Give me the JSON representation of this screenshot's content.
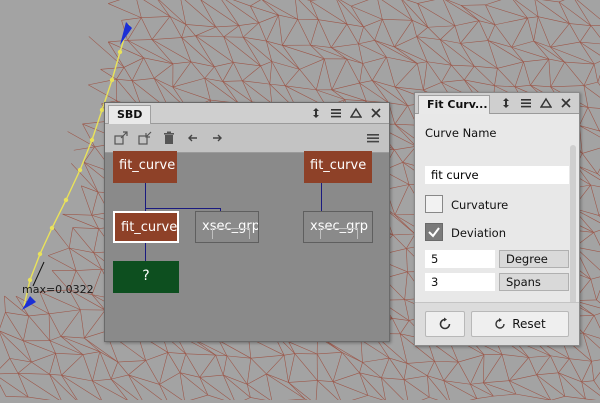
{
  "viewport": {
    "max_label": "max=0.0322"
  },
  "sbd": {
    "title": "SBD",
    "nodes": {
      "fit_curve_top_left": "fit_curve",
      "fit_curve_top_right": "fit_curve",
      "fit_curve_selected": "fit_curve",
      "xsec_left": "xsec_grp",
      "xsec_right": "xsec_grp",
      "leaf": "?"
    }
  },
  "fit": {
    "title": "Fit Curv...",
    "curve_name_label": "Curve Name",
    "curve_name_value": "fit curve",
    "curvature_label": "Curvature",
    "curvature_checked": false,
    "deviation_label": "Deviation",
    "deviation_checked": true,
    "degree_value": "5",
    "degree_label": "Degree",
    "spans_value": "3",
    "spans_label": "Spans",
    "reset_label": "Reset"
  },
  "colors": {
    "node_red": "#8e4128",
    "node_green": "#0d4f1f",
    "mesh": "#9b4a3a",
    "curve": "#e9e25a"
  }
}
